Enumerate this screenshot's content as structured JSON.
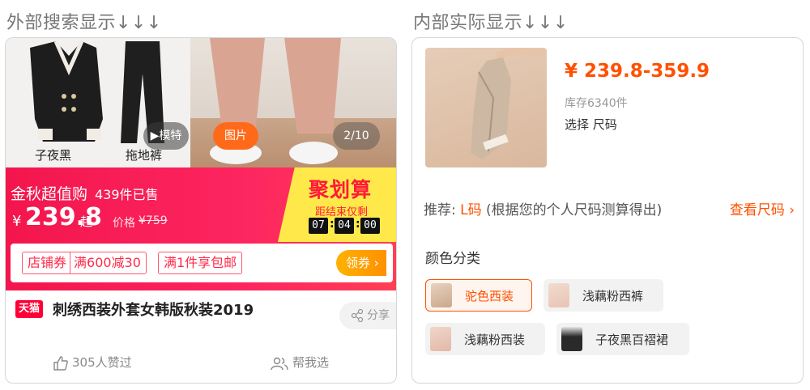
{
  "headings": {
    "left": "外部搜索显示↓↓↓",
    "right": "内部实际显示↓↓↓"
  },
  "search_card": {
    "gallery": {
      "captions": [
        "子夜黑",
        "拖地裤"
      ],
      "model_button": "▶模特",
      "picture_button": "图片",
      "counter": "2/10"
    },
    "promo": {
      "title": "金秋超值购",
      "sold": "439件已售",
      "currency": "¥",
      "price": "239.8",
      "price_suffix": "起",
      "list_price_label": "价格",
      "list_price": "¥759",
      "juhuasuan": {
        "title": "聚划算",
        "subtitle": "距结束仅剩",
        "countdown": [
          "07",
          "04",
          "00"
        ]
      },
      "coupons": {
        "shop_label": "店铺券",
        "shop_offer": "满600减30",
        "shipping": "满1件享包邮",
        "claim": "领券"
      }
    },
    "badge": "天猫",
    "product_title": "刺绣西装外套女韩版秋装2019",
    "share": "分享",
    "likes": "305人赞过",
    "help_choose": "帮我选",
    "icons": {
      "play": "play-icon",
      "chevron": "chevron-right-icon",
      "share": "share-icon",
      "like": "thumbs-up-icon",
      "help": "people-icon"
    }
  },
  "detail_card": {
    "price": "¥ 239.8-359.9",
    "stock": "库存6340件",
    "select": "选择 尺码",
    "recommend": {
      "prefix": "推荐: ",
      "size": "L码",
      "note": " (根据您的个人尺码测算得出)"
    },
    "size_chart": "查看尺码",
    "color_label": "颜色分类",
    "colors": [
      {
        "label": "驼色西装",
        "selected": true,
        "swatch": "#c9a88c"
      },
      {
        "label": "浅藕粉西裤",
        "selected": false,
        "swatch": "#e8c3b2"
      },
      {
        "label": "浅藕粉西装",
        "selected": false,
        "swatch": "#e3b8a6"
      },
      {
        "label": "子夜黑百褶裙",
        "selected": false,
        "swatch": "#2a2a2a"
      }
    ]
  },
  "colors": {
    "accent": "#ff5000",
    "promo_red": "#f3164d",
    "tmall_red": "#ff0036",
    "juhuasuan_yellow": "#ffe94a"
  }
}
